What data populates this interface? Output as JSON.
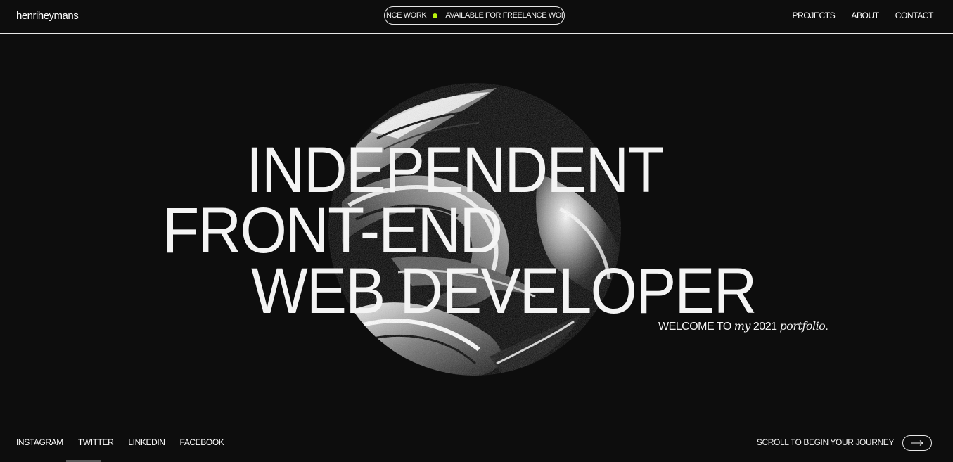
{
  "header": {
    "logo": "henriheymans",
    "ticker": {
      "segment_a": "NCE WORK",
      "segment_b": "AVAILABLE FOR FREELANCE WORK",
      "dot_color": "#b7f20d"
    },
    "nav": [
      {
        "label": "PROJECTS"
      },
      {
        "label": "ABOUT"
      },
      {
        "label": "CONTACT"
      }
    ]
  },
  "hero": {
    "line1": "INDEPENDENT",
    "line2": "FRONT-END",
    "line3": "WEB DEVELOPER",
    "welcome": {
      "prefix": "WELCOME TO",
      "my": "my",
      "year": "2021",
      "portfolio": "portfolio",
      "suffix": "."
    }
  },
  "footer": {
    "socials": [
      {
        "label": "INSTAGRAM"
      },
      {
        "label": "TWITTER"
      },
      {
        "label": "LINKEDIN"
      },
      {
        "label": "FACEBOOK"
      }
    ],
    "scroll_label": "SCROLL TO BEGIN YOUR JOURNEY",
    "scroll_icon": "arrow-right-icon"
  },
  "colors": {
    "background": "#0d0d0d",
    "text": "#f4f4f4",
    "accent": "#b7f20d"
  }
}
